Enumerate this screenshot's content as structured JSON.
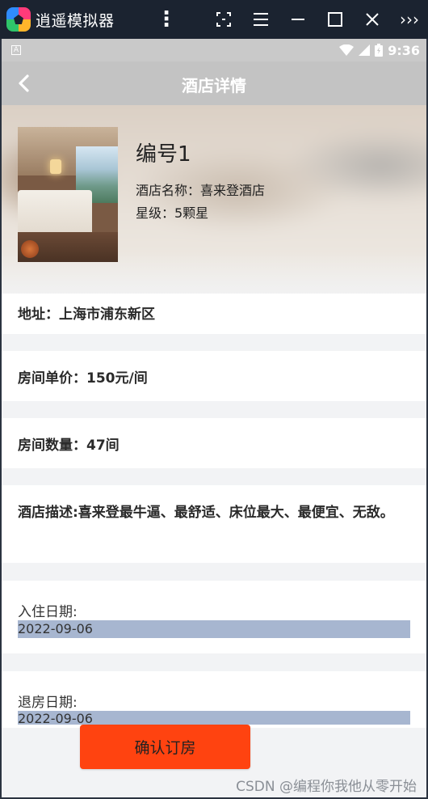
{
  "emulator": {
    "title": "逍遥模拟器",
    "more_glyph": "⋮",
    "expand_glyph": "›››"
  },
  "status_bar": {
    "time": "9:36",
    "indicator": "A"
  },
  "header": {
    "title": "酒店详情"
  },
  "hotel": {
    "code": "编号1",
    "name_line": "酒店名称：喜来登酒店",
    "star_line": "星级：5颗星"
  },
  "details": {
    "address": "地址：上海市浦东新区",
    "price": "房间单价：150元/间",
    "rooms": "房间数量：47间",
    "description": "酒店描述:喜来登最牛逼、最舒适、床位最大、最便宜、无敌。"
  },
  "booking": {
    "checkin_label": "入住日期:",
    "checkin_value": "2022-09-06",
    "checkout_label": "退房日期:",
    "checkout_value": "2022-09-06",
    "confirm_label": "确认订房"
  },
  "watermark": "CSDN @编程你我他从零开始",
  "colors": {
    "emulator_bar": "#1b2330",
    "header": "#c3c3c3",
    "confirm_button": "#ff4310",
    "date_field": "#a7b6d0"
  }
}
